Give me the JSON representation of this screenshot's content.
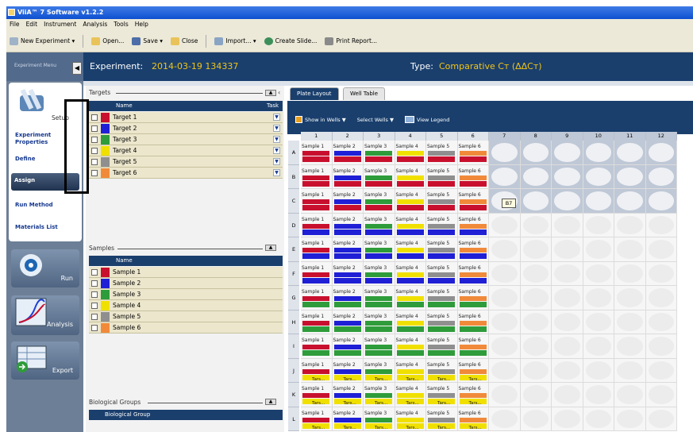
{
  "title": "ViiA™ 7 Software v1.2.2",
  "menu": [
    "File",
    "Edit",
    "Instrument",
    "Analysis",
    "Tools",
    "Help"
  ],
  "toolbar": [
    "New Experiment ▾",
    "Open...",
    "Save ▾",
    "Close",
    "Import... ▾",
    "Create Slide...",
    "Print Report..."
  ],
  "nav": {
    "experiment_menu": "Experiment Menu",
    "setup": "Setup",
    "links": [
      "Experiment Properties",
      "Define",
      "Assign",
      "Run Method",
      "Materials List"
    ],
    "run": "Run",
    "analysis": "Analysis",
    "export": "Export"
  },
  "header": {
    "exp_label": "Experiment:",
    "exp_name": "2014-03-19 134337",
    "type_label": "Type:",
    "type_value": "Comparative Cᴛ (ΔΔCᴛ)"
  },
  "targets": {
    "title": "Targets",
    "col_name": "Name",
    "col_task": "Task",
    "items": [
      {
        "name": "Target 1",
        "color": "#c8102e"
      },
      {
        "name": "Target 2",
        "color": "#1f1fd6"
      },
      {
        "name": "Target 3",
        "color": "#2e9c3a"
      },
      {
        "name": "Target 4",
        "color": "#f0e000"
      },
      {
        "name": "Target 5",
        "color": "#8f8f8f"
      },
      {
        "name": "Target 6",
        "color": "#f08a3a"
      }
    ]
  },
  "samples": {
    "title": "Samples",
    "col_name": "Name",
    "items": [
      {
        "name": "Sample 1",
        "color": "#c8102e"
      },
      {
        "name": "Sample 2",
        "color": "#1f1fd6"
      },
      {
        "name": "Sample 3",
        "color": "#2e9c3a"
      },
      {
        "name": "Sample 4",
        "color": "#f0e000"
      },
      {
        "name": "Sample 5",
        "color": "#8f8f8f"
      },
      {
        "name": "Sample 6",
        "color": "#f08a3a"
      }
    ]
  },
  "bio_groups": {
    "title": "Biological Groups",
    "col_name": "Biological Group"
  },
  "tabs": [
    "Plate Layout",
    "Well Table"
  ],
  "plate_opts": [
    "Show in Wells ▼",
    "Select Wells ▼",
    "View Legend"
  ],
  "plate": {
    "cols": [
      "1",
      "2",
      "3",
      "4",
      "5",
      "6",
      "7",
      "8",
      "9",
      "10",
      "11",
      "12"
    ],
    "rows": [
      "A",
      "B",
      "C",
      "D",
      "E",
      "F",
      "G",
      "H",
      "I",
      "J",
      "K",
      "L"
    ],
    "sample_names": [
      "Sample 1",
      "Sample 2",
      "Sample 3",
      "Sample 4",
      "Sample 5",
      "Sample 6"
    ],
    "row_colors": {
      "A": "#c8102e",
      "B": "#c8102e",
      "C": "#c8102e",
      "D": "#1f1fd6",
      "E": "#1f1fd6",
      "F": "#1f1fd6",
      "G": "#2e9c3a",
      "H": "#2e9c3a",
      "I": "#2e9c3a",
      "J": "#f0e000",
      "K": "#f0e000",
      "L": "#f0e000"
    },
    "target_tag": "Tars...",
    "selected_well": "B7"
  }
}
